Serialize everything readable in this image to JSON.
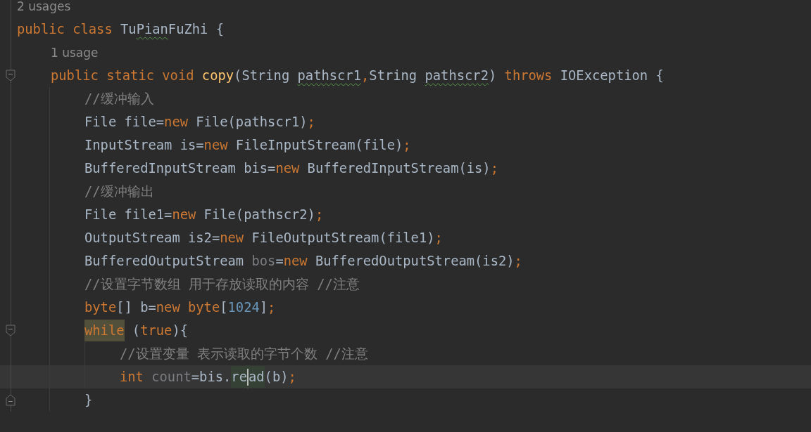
{
  "editor": {
    "lines": [
      {
        "kind": "hint",
        "text": "2 usages"
      },
      {
        "kind": "code",
        "tokens": [
          {
            "kind": "keyword",
            "text": "public class "
          },
          {
            "kind": "plain",
            "text": "Tu"
          },
          {
            "kind": "typo",
            "text": "Pian"
          },
          {
            "kind": "plain",
            "text": "FuZhi {"
          }
        ],
        "children": [
          {
            "kind": "hint",
            "text": "1 usage"
          },
          {
            "kind": "fold-start",
            "tokens": [
              {
                "kind": "keyword",
                "text": "public static void "
              },
              {
                "kind": "method",
                "text": "copy"
              },
              {
                "kind": "plain",
                "text": "(String "
              },
              {
                "kind": "typo",
                "text": "pathscr1"
              },
              {
                "kind": "keyword",
                "text": ","
              },
              {
                "kind": "plain",
                "text": "String "
              },
              {
                "kind": "typo",
                "text": "pathscr2"
              },
              {
                "kind": "plain",
                "text": ") "
              },
              {
                "kind": "keyword",
                "text": "throws"
              },
              {
                "kind": "plain",
                "text": " IOException {"
              }
            ],
            "children": [
              {
                "kind": "code",
                "tokens": [
                  {
                    "kind": "comment",
                    "text": "//缓冲输入"
                  }
                ]
              },
              {
                "kind": "code",
                "tokens": [
                  {
                    "kind": "plain",
                    "text": "File file="
                  },
                  {
                    "kind": "keyword",
                    "text": "new"
                  },
                  {
                    "kind": "plain",
                    "text": " File(pathscr1)"
                  },
                  {
                    "kind": "keyword",
                    "text": ";"
                  }
                ]
              },
              {
                "kind": "code",
                "tokens": [
                  {
                    "kind": "plain",
                    "text": "InputStream is="
                  },
                  {
                    "kind": "keyword",
                    "text": "new"
                  },
                  {
                    "kind": "plain",
                    "text": " FileInputStream(file)"
                  },
                  {
                    "kind": "keyword",
                    "text": ";"
                  }
                ]
              },
              {
                "kind": "code",
                "tokens": [
                  {
                    "kind": "plain",
                    "text": "BufferedInputStream bis="
                  },
                  {
                    "kind": "keyword",
                    "text": "new"
                  },
                  {
                    "kind": "plain",
                    "text": " BufferedInputStream(is)"
                  },
                  {
                    "kind": "keyword",
                    "text": ";"
                  }
                ]
              },
              {
                "kind": "code",
                "tokens": [
                  {
                    "kind": "comment",
                    "text": "//缓冲输出"
                  }
                ]
              },
              {
                "kind": "code",
                "tokens": [
                  {
                    "kind": "plain",
                    "text": "File file1="
                  },
                  {
                    "kind": "keyword",
                    "text": "new"
                  },
                  {
                    "kind": "plain",
                    "text": " File(pathscr2)"
                  },
                  {
                    "kind": "keyword",
                    "text": ";"
                  }
                ]
              },
              {
                "kind": "code",
                "tokens": [
                  {
                    "kind": "plain",
                    "text": "OutputStream is2="
                  },
                  {
                    "kind": "keyword",
                    "text": "new"
                  },
                  {
                    "kind": "plain",
                    "text": " FileOutputStream(file1)"
                  },
                  {
                    "kind": "keyword",
                    "text": ";"
                  }
                ]
              },
              {
                "kind": "code",
                "tokens": [
                  {
                    "kind": "plain",
                    "text": "BufferedOutputStream "
                  },
                  {
                    "kind": "unused",
                    "text": "bos"
                  },
                  {
                    "kind": "plain",
                    "text": "="
                  },
                  {
                    "kind": "keyword",
                    "text": "new"
                  },
                  {
                    "kind": "plain",
                    "text": " BufferedOutputStream(is2)"
                  },
                  {
                    "kind": "keyword",
                    "text": ";"
                  }
                ]
              },
              {
                "kind": "code",
                "tokens": [
                  {
                    "kind": "comment",
                    "text": "//设置字节数组 用于存放读取的内容 //注意"
                  }
                ]
              },
              {
                "kind": "code",
                "tokens": [
                  {
                    "kind": "keyword",
                    "text": "byte"
                  },
                  {
                    "kind": "plain",
                    "text": "[] b="
                  },
                  {
                    "kind": "keyword",
                    "text": "new byte"
                  },
                  {
                    "kind": "plain",
                    "text": "["
                  },
                  {
                    "kind": "number",
                    "text": "1024"
                  },
                  {
                    "kind": "plain",
                    "text": "]"
                  },
                  {
                    "kind": "keyword",
                    "text": ";"
                  }
                ]
              },
              {
                "kind": "fold-start",
                "tokens": [
                  {
                    "kind": "highlight-keyword",
                    "text": "while"
                  },
                  {
                    "kind": "plain",
                    "text": " ("
                  },
                  {
                    "kind": "keyword",
                    "text": "true"
                  },
                  {
                    "kind": "plain",
                    "text": "){"
                  }
                ],
                "children": [
                  {
                    "kind": "code",
                    "tokens": [
                      {
                        "kind": "comment",
                        "text": "//设置变量 表示读取的字节个数 //注意"
                      }
                    ]
                  },
                  {
                    "kind": "code",
                    "tokens": [
                      {
                        "kind": "keyword",
                        "text": "int "
                      },
                      {
                        "kind": "unused",
                        "text": "count"
                      },
                      {
                        "kind": "plain",
                        "text": "=bis."
                      },
                      {
                        "kind": "highlight-plain",
                        "text": "re"
                      },
                      {
                        "kind": "caret"
                      },
                      {
                        "kind": "highlight-plain",
                        "text": "ad"
                      },
                      {
                        "kind": "plain",
                        "text": "(b)"
                      },
                      {
                        "kind": "keyword",
                        "text": ";"
                      }
                    ]
                  }
                ]
              },
              {
                "kind": "fold-end",
                "tokens": [
                  {
                    "kind": "plain",
                    "text": "}"
                  }
                ]
              }
            ]
          }
        ]
      }
    ]
  }
}
